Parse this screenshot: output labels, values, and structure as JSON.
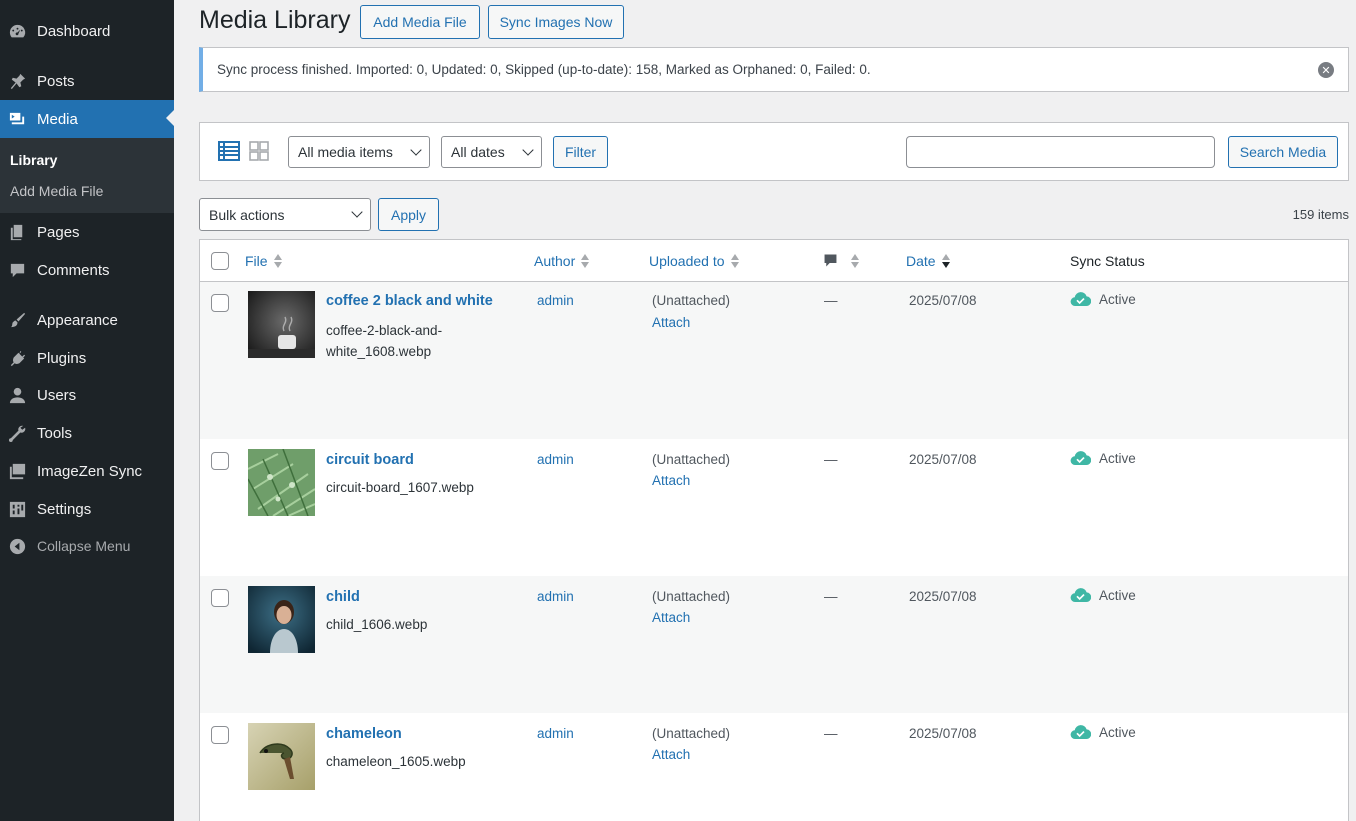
{
  "sidebar": {
    "items": [
      {
        "label": "Dashboard",
        "icon": "dashboard-icon"
      },
      {
        "label": "Posts",
        "icon": "pin-icon"
      },
      {
        "label": "Media",
        "icon": "media-icon"
      },
      {
        "label": "Pages",
        "icon": "pages-icon"
      },
      {
        "label": "Comments",
        "icon": "comment-icon"
      },
      {
        "label": "Appearance",
        "icon": "paintbrush-icon"
      },
      {
        "label": "Plugins",
        "icon": "plug-icon"
      },
      {
        "label": "Users",
        "icon": "user-icon"
      },
      {
        "label": "Tools",
        "icon": "wrench-icon"
      },
      {
        "label": "ImageZen Sync",
        "icon": "images-icon"
      },
      {
        "label": "Settings",
        "icon": "settings-icon"
      }
    ],
    "submenu": [
      "Library",
      "Add Media File"
    ],
    "collapse_label": "Collapse Menu"
  },
  "header": {
    "title": "Media Library",
    "add_button": "Add Media File",
    "sync_button": "Sync Images Now"
  },
  "notice": {
    "text": "Sync process finished. Imported: 0, Updated: 0, Skipped (up-to-date): 158, Marked as Orphaned: 0, Failed: 0."
  },
  "filters": {
    "media_type": "All media items",
    "dates": "All dates",
    "filter_button": "Filter",
    "search_placeholder": "",
    "search_button": "Search Media"
  },
  "bulk": {
    "selected": "Bulk actions",
    "apply": "Apply",
    "items_count": "159 items"
  },
  "table": {
    "headers": {
      "file": "File",
      "author": "Author",
      "uploaded_to": "Uploaded to",
      "comments_icon": "comment-icon",
      "date": "Date",
      "sync_status": "Sync Status"
    },
    "rows": [
      {
        "title": "coffee 2 black and white",
        "file_line1": "coffee-2-black-and-",
        "file_line2": "white_1608.webp",
        "author": "admin",
        "uploaded": "(Unattached)",
        "attach": "Attach",
        "comments": "—",
        "date": "2025/07/08",
        "status": "Active"
      },
      {
        "title": "circuit board",
        "file_line1": "circuit-board_1607.webp",
        "file_line2": "",
        "author": "admin",
        "uploaded": "(Unattached)",
        "attach": "Attach",
        "comments": "—",
        "date": "2025/07/08",
        "status": "Active"
      },
      {
        "title": "child",
        "file_line1": "child_1606.webp",
        "file_line2": "",
        "author": "admin",
        "uploaded": "(Unattached)",
        "attach": "Attach",
        "comments": "—",
        "date": "2025/07/08",
        "status": "Active"
      },
      {
        "title": "chameleon",
        "file_line1": "chameleon_1605.webp",
        "file_line2": "",
        "author": "admin",
        "uploaded": "(Unattached)",
        "attach": "Attach",
        "comments": "—",
        "date": "2025/07/08",
        "status": "Active"
      }
    ]
  },
  "colors": {
    "sidebar_bg": "#1d2327",
    "accent": "#2271b1",
    "status_ok": "#3fb7a5"
  }
}
